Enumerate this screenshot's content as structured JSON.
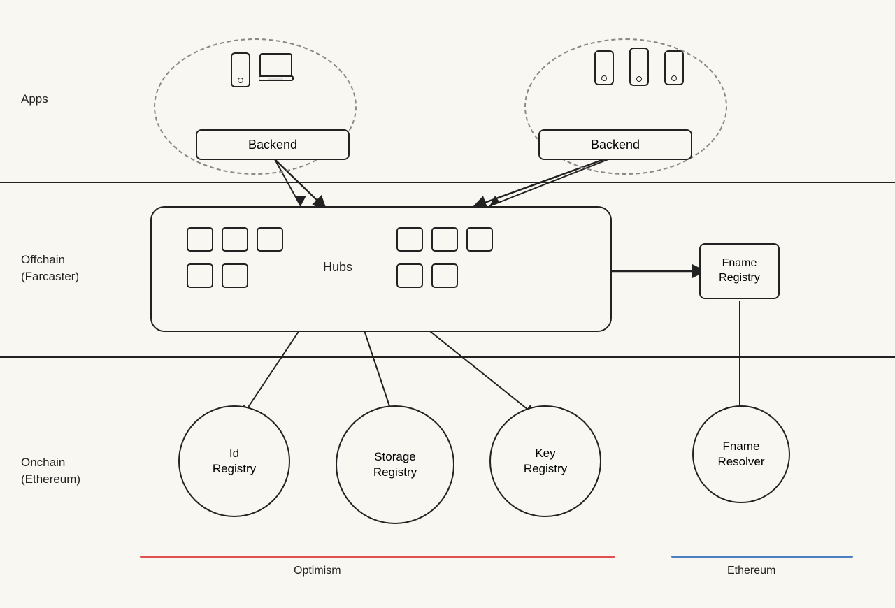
{
  "labels": {
    "apps": "Apps",
    "offchain": "Offchain\n(Farcaster)",
    "onchain": "Onchain\n(Ethereum)",
    "optimism": "Optimism",
    "ethereum": "Ethereum",
    "backend1": "Backend",
    "backend2": "Backend",
    "hubs": "Hubs",
    "fname_registry_offchain": "Fname\nRegistry",
    "id_registry": "Id\nRegistry",
    "storage_registry": "Storage\nRegistry",
    "key_registry": "Key\nRegistry",
    "fname_resolver": "Fname\nResolver"
  },
  "colors": {
    "red_line": "#e05050",
    "blue_line": "#4a7fc1",
    "stroke": "#222",
    "background": "#f8f7f2"
  }
}
